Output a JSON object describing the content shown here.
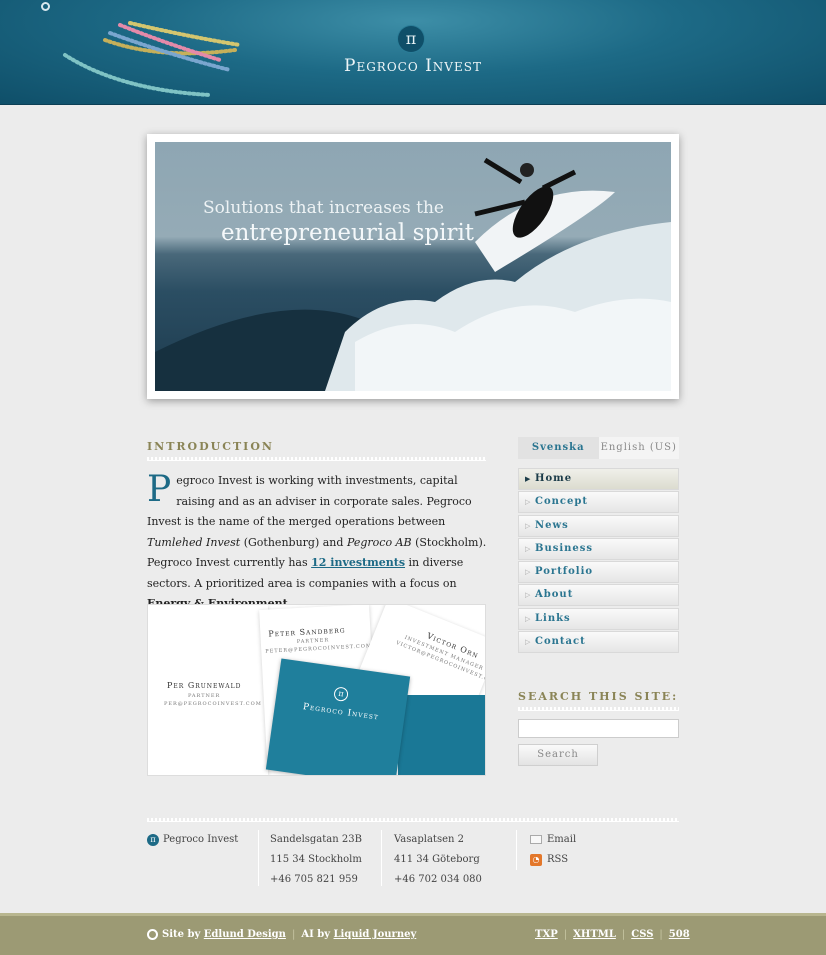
{
  "header": {
    "logo_glyph": "π",
    "brand": "Pegroco Invest"
  },
  "hero": {
    "line1": "Solutions that increases the",
    "line2": "entrepreneurial spirit"
  },
  "intro": {
    "title": "INTRODUCTION",
    "dropcap": "P",
    "p1": "egroco Invest is working with investments, capital raising and as an adviser in corporate sales. Pegroco Invest is the name of the merged operations between ",
    "em1": "Tumlehed Invest",
    "p2": " (Gothenburg) and ",
    "em2": "Pegroco AB",
    "p3": " (Stockholm). Pegroco Invest currently has ",
    "link": "12 investments",
    "p4": " in diverse sectors. A prioritized area is companies with a focus on ",
    "strong": "Energy & Environment",
    "p5": "."
  },
  "cards": {
    "per_name": "Per Grunewald",
    "per_role": "PARTNER",
    "per_email": "PER@PEGROCOINVEST.COM",
    "peter_name": "Peter Sandberg",
    "peter_role": "PARTNER",
    "peter_email": "PETER@PEGROCOINVEST.COM",
    "victor_name": "Victor Orn",
    "victor_role": "INVESTMENT MANAGER",
    "victor_email": "VICTOR@PEGROCOINVEST.COM",
    "blue_glyph": "π",
    "blue_brand": "Pegroco Invest",
    "blue_colors": [
      "#1a7896",
      "#1f7f9c"
    ]
  },
  "language": {
    "svenska": "Svenska",
    "english": "English (US)"
  },
  "nav": {
    "items": [
      {
        "label": "Home",
        "icon": "arrow-right-icon"
      },
      {
        "label": "Concept",
        "icon": "arrow-right-icon"
      },
      {
        "label": "News",
        "icon": "arrow-right-icon"
      },
      {
        "label": "Business",
        "icon": "arrow-right-icon"
      },
      {
        "label": "Portfolio",
        "icon": "arrow-right-icon"
      },
      {
        "label": "About",
        "icon": "arrow-right-icon"
      },
      {
        "label": "Links",
        "icon": "arrow-right-icon"
      },
      {
        "label": "Contact",
        "icon": "arrow-right-icon"
      }
    ]
  },
  "search": {
    "title": "SEARCH THIS SITE:",
    "value": "",
    "button": "Search"
  },
  "footer": {
    "company": "Pegroco Invest",
    "sthlm_street": "Sandelsgatan 23B",
    "sthlm_city": "115 34  Stockholm",
    "sthlm_phone": "+46 705 821 959",
    "gbg_street": "Vasaplatsen 2",
    "gbg_city": "411 34  Göteborg",
    "gbg_phone": "+46 702 034 080",
    "email": "Email",
    "rss": "RSS"
  },
  "bottombar": {
    "site_by_prefix": "Site by ",
    "site_by": "Edlund Design",
    "ai_by_prefix": "AI by ",
    "ai_by": "Liquid Journey",
    "sep": "|",
    "links": [
      "TXP",
      "XHTML",
      "CSS",
      "508"
    ]
  },
  "colors": {
    "teal": "#1d6a86",
    "olive": "#9c9a74",
    "heading_olive": "#8a8456"
  }
}
